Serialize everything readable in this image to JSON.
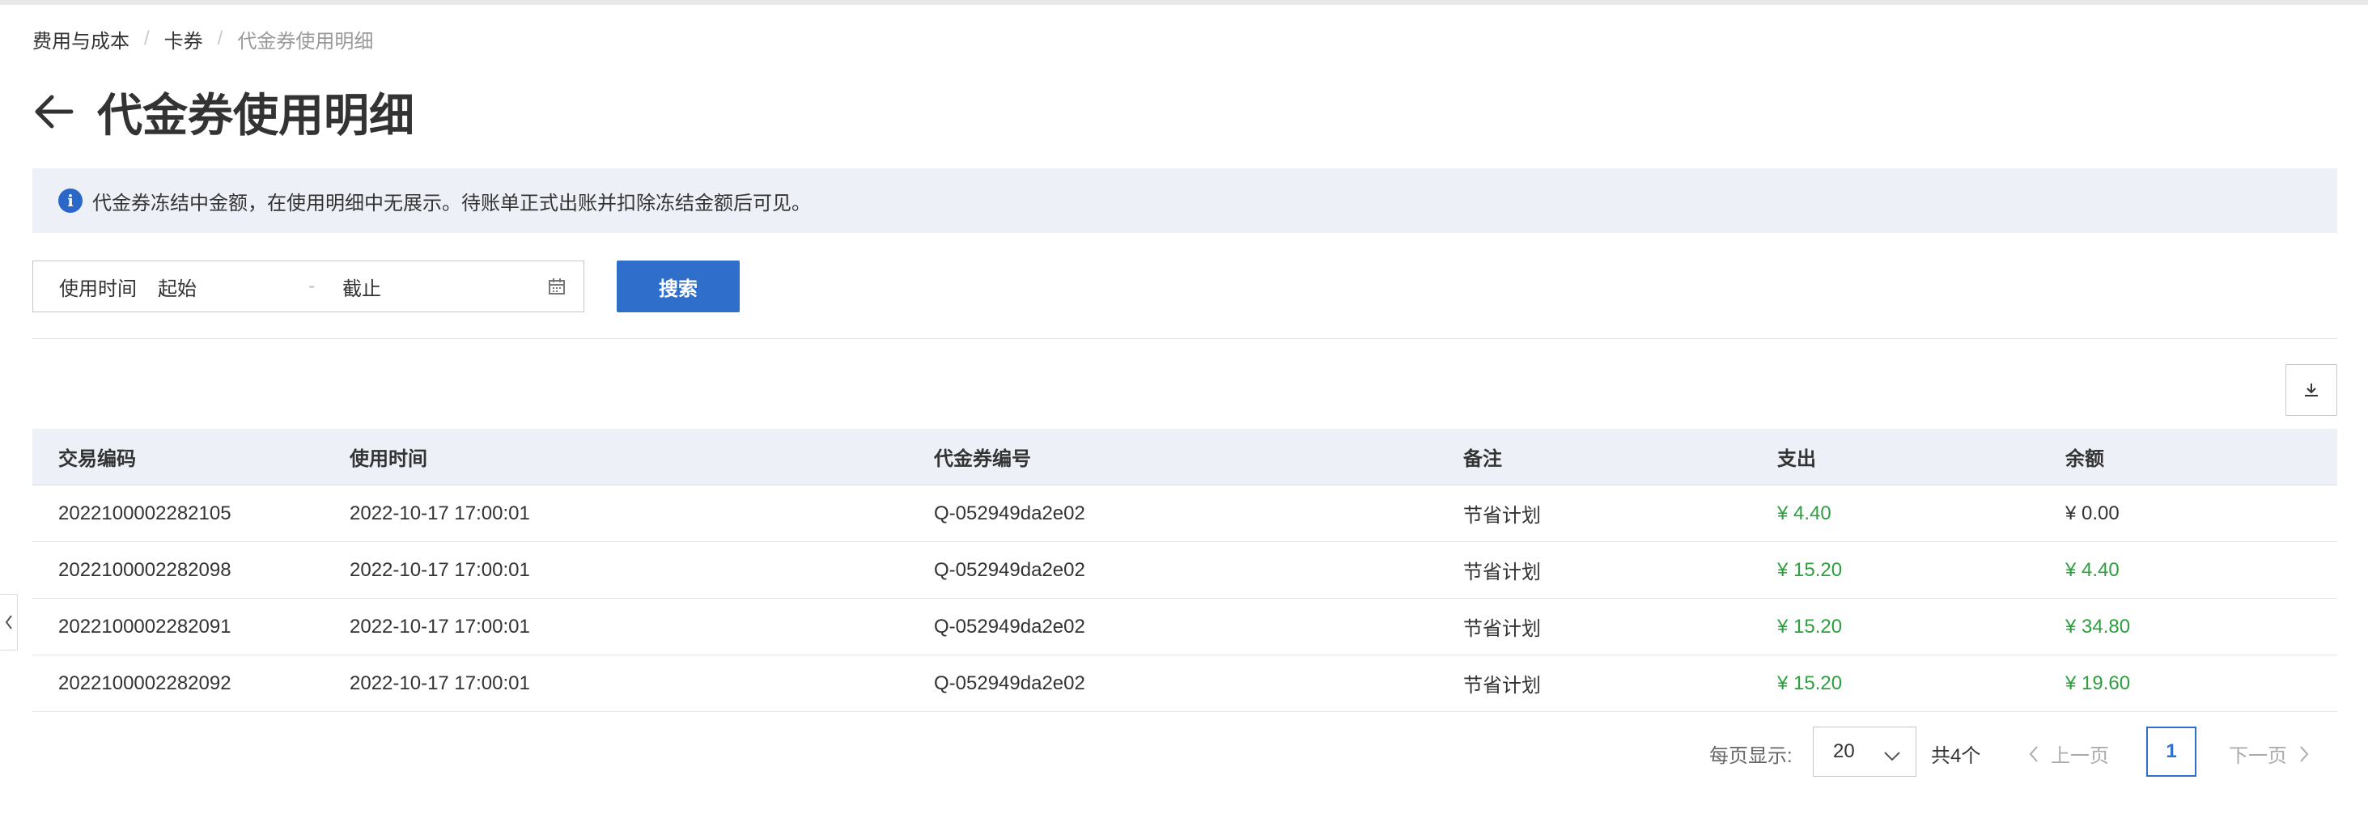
{
  "breadcrumb": {
    "items": [
      "费用与成本",
      "卡券",
      "代金券使用明细"
    ]
  },
  "page": {
    "title": "代金券使用明细"
  },
  "notice": {
    "text": "代金券冻结中金额，在使用明细中无展示。待账单正式出账并扣除冻结金额后可见。"
  },
  "filter": {
    "label": "使用时间",
    "start_placeholder": "起始",
    "separator": "-",
    "end_placeholder": "截止",
    "search_label": "搜索"
  },
  "table": {
    "headers": [
      "交易编码",
      "使用时间",
      "代金券编号",
      "备注",
      "支出",
      "余额"
    ],
    "rows": [
      [
        "2022100002282105",
        "2022-10-17 17:00:01",
        "Q-052949da2e02",
        "节省计划",
        "¥ 4.40",
        "¥ 0.00"
      ],
      [
        "2022100002282098",
        "2022-10-17 17:00:01",
        "Q-052949da2e02",
        "节省计划",
        "¥ 15.20",
        "¥ 4.40"
      ],
      [
        "2022100002282091",
        "2022-10-17 17:00:01",
        "Q-052949da2e02",
        "节省计划",
        "¥ 15.20",
        "¥ 34.80"
      ],
      [
        "2022100002282092",
        "2022-10-17 17:00:01",
        "Q-052949da2e02",
        "节省计划",
        "¥ 15.20",
        "¥ 19.60"
      ]
    ]
  },
  "pagination": {
    "page_size_label": "每页显示:",
    "page_size": "20",
    "total": "共4个",
    "prev_label": "上一页",
    "current_page": "1",
    "next_label": "下一页"
  },
  "colors": {
    "accent": "#2f6ecb",
    "positive": "#2e9e3f",
    "notice_bg": "#edf1f7"
  }
}
